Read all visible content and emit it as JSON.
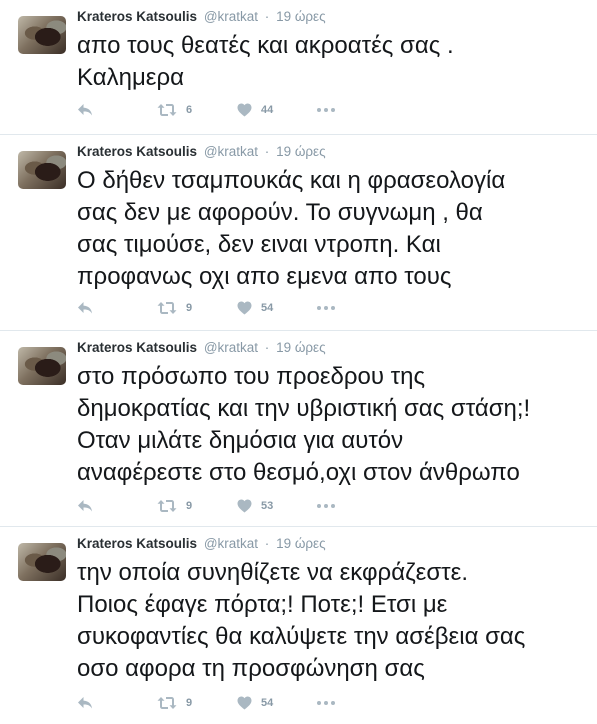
{
  "tweets": [
    {
      "author_name": "Krateros Katsoulis",
      "author_handle": "@kratkat",
      "separator": "·",
      "time": "19 ώρες",
      "text": "απο τους θεατές και ακροατές σας .\nΚαλημερα",
      "retweets": "6",
      "likes": "44"
    },
    {
      "author_name": "Krateros Katsoulis",
      "author_handle": "@kratkat",
      "separator": "·",
      "time": "19 ώρες",
      "text": "Ο δήθεν τσαμπουκάς και η φρασεολογία\nσας δεν με αφορούν. Το συγνωμη ,  θα\nσας τιμούσε, δεν ειναι ντροπη. Και\nπροφανως οχι απο εμενα απο τους",
      "retweets": "9",
      "likes": "54"
    },
    {
      "author_name": "Krateros Katsoulis",
      "author_handle": "@kratkat",
      "separator": "·",
      "time": "19 ώρες",
      "text": "στο πρόσωπο του  προεδρου της\nδημοκρατίας και την υβριστική σας στάση;!\nΟταν μιλάτε δημόσια για αυτόν\nαναφέρεστε στο θεσμό,οχι στον άνθρωπο",
      "retweets": "9",
      "likes": "53"
    },
    {
      "author_name": "Krateros Katsoulis",
      "author_handle": "@kratkat",
      "separator": "·",
      "time": "19 ώρες",
      "text": "την οποία συνηθίζετε να εκφράζεστε.\nΠοιος έφαγε πόρτα;! Ποτε;! Ετσι με\nσυκοφαντίες θα καλύψετε την ασέβεια σας\nοσο αφορα τη προσφώνηση σας",
      "retweets": "9",
      "likes": "54"
    }
  ],
  "icons": {
    "reply": "reply-icon",
    "retweet": "retweet-icon",
    "like": "heart-icon",
    "more": "more-icon"
  },
  "colors": {
    "name": "#292f33",
    "meta": "#8899a6",
    "text": "#14171a",
    "action_icon": "#aab8c2",
    "divider": "#e1e8ed"
  }
}
